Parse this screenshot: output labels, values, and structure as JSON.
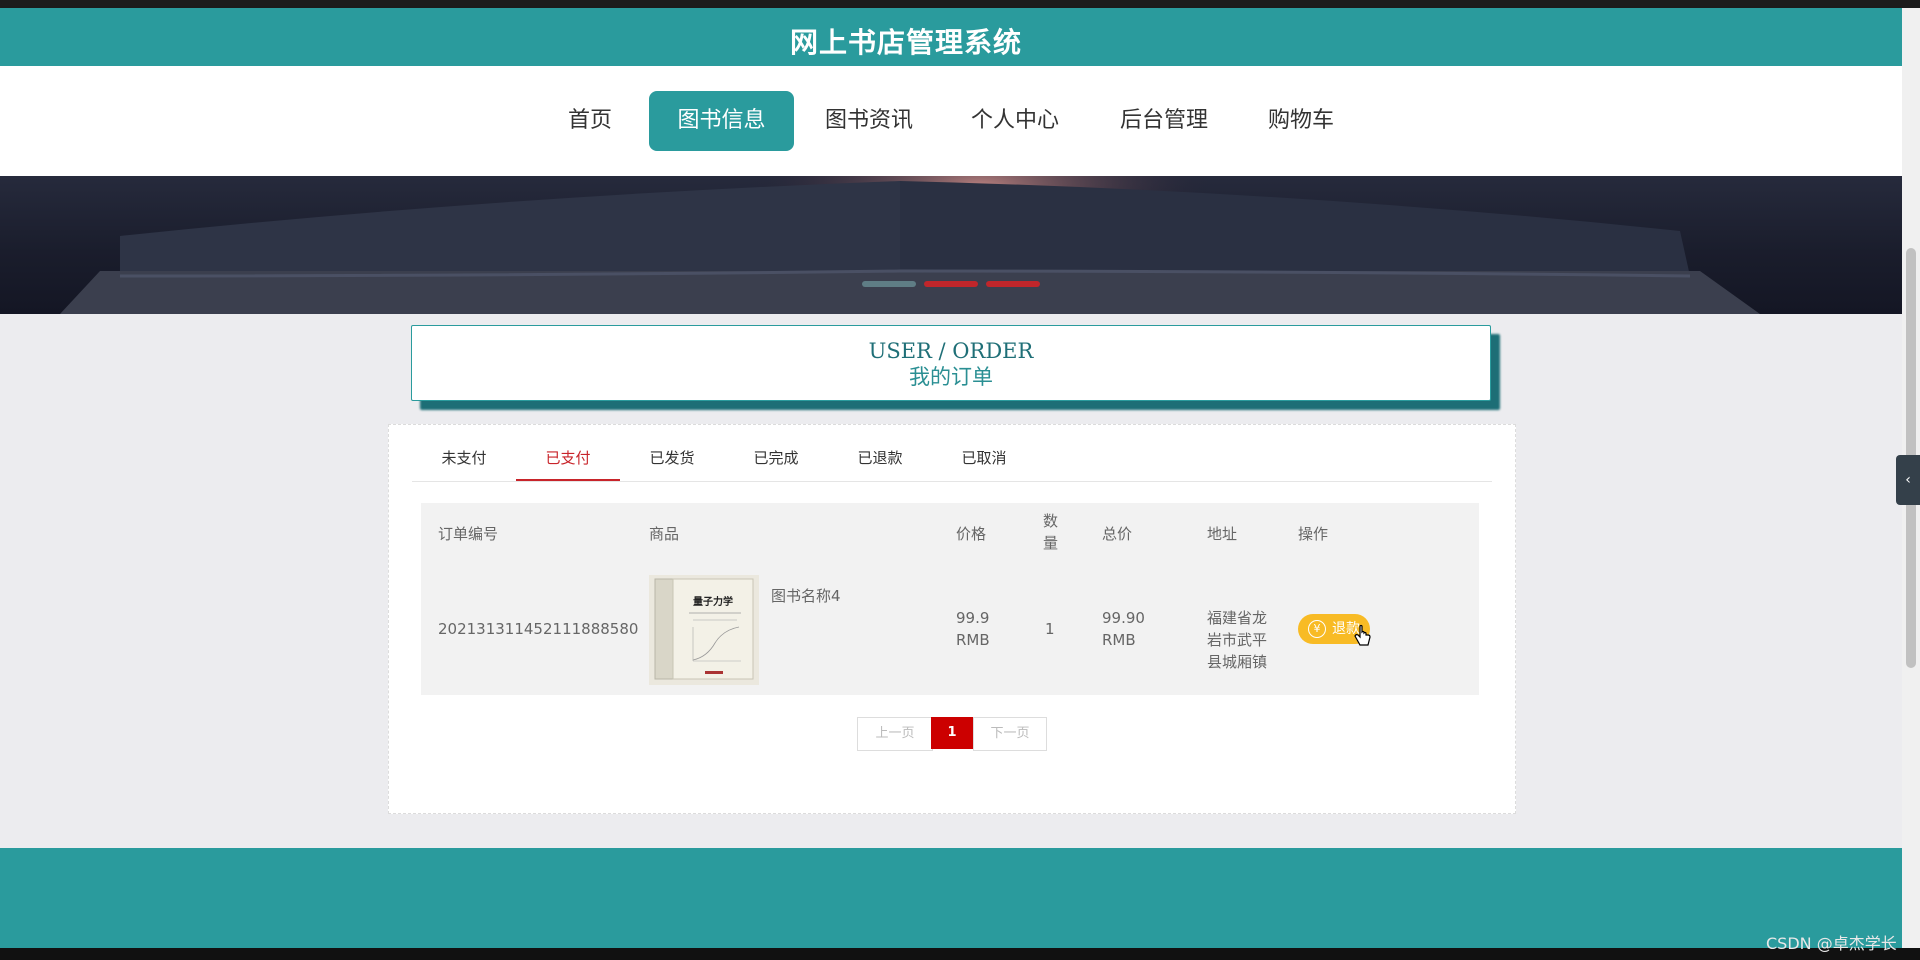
{
  "header": {
    "title": "网上书店管理系统"
  },
  "nav": {
    "items": [
      {
        "label": "首页"
      },
      {
        "label": "图书信息",
        "active": true
      },
      {
        "label": "图书资讯"
      },
      {
        "label": "个人中心"
      },
      {
        "label": "后台管理"
      },
      {
        "label": "购物车"
      }
    ]
  },
  "banner": {
    "dots": 3,
    "active_dot": 1
  },
  "section": {
    "title_en": "USER / ORDER",
    "title_cn": "我的订单"
  },
  "tabs": [
    {
      "label": "未支付"
    },
    {
      "label": "已支付",
      "active": true
    },
    {
      "label": "已发货"
    },
    {
      "label": "已完成"
    },
    {
      "label": "已退款"
    },
    {
      "label": "已取消"
    }
  ],
  "table": {
    "headers": {
      "order_no": "订单编号",
      "product": "商品",
      "price": "价格",
      "qty": "数量",
      "total": "总价",
      "address": "地址",
      "action": "操作"
    },
    "rows": [
      {
        "order_no": "20213131145211188858​0",
        "product_name": "图书名称4",
        "cover_title": "量子力学",
        "price": "99.9",
        "price_unit": "RMB",
        "qty": "1",
        "total": "99.90",
        "total_unit": "RMB",
        "address": "福建省龙岩市武平县城厢镇",
        "action_label": "退款",
        "action_icon": "yen-icon"
      }
    ]
  },
  "pagination": {
    "prev": "上一页",
    "current": "1",
    "next": "下一页"
  },
  "watermark": "CSDN @卓杰学长",
  "colors": {
    "primary": "#2a9b9d",
    "active_tab": "#c8242a",
    "refund": "#f8bb25",
    "page_active": "#cc0000"
  }
}
